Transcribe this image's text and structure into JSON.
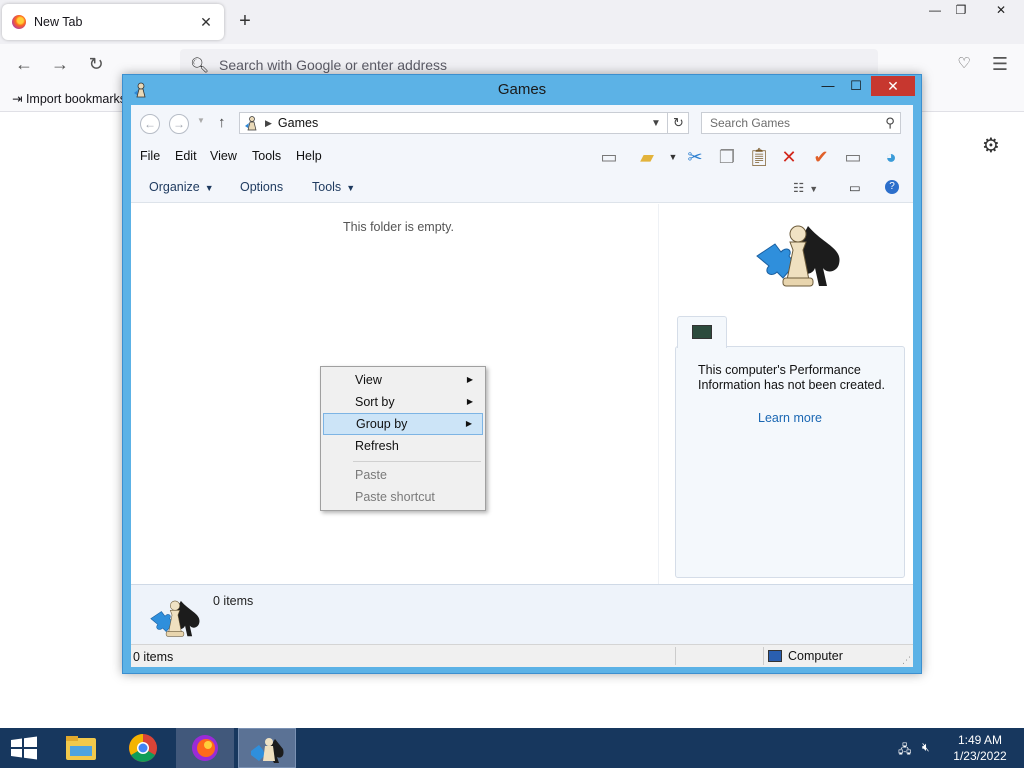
{
  "browser": {
    "tab_title": "New Tab",
    "tab_close": "✕",
    "new_tab": "+",
    "url_placeholder": "Search with Google or enter address",
    "bookmark_label": "Import bookmarks...",
    "controls": {
      "minimize": "—",
      "maximize": "❐",
      "close": "✕"
    }
  },
  "explorer": {
    "title": "Games",
    "breadcrumb": "Games",
    "search_placeholder": "Search Games",
    "menu": [
      "File",
      "Edit",
      "View",
      "Tools",
      "Help"
    ],
    "commands": {
      "organize": "Organize",
      "options": "Options",
      "tools": "Tools"
    },
    "empty_message": "This folder is empty.",
    "perf_message": "This computer's Performance Information has not been created.",
    "learn_more": "Learn more",
    "details_count": "0 items",
    "status_items": "0 items",
    "status_location": "Computer"
  },
  "context_menu": {
    "items": [
      {
        "label": "View",
        "submenu": true,
        "disabled": false
      },
      {
        "label": "Sort by",
        "submenu": true,
        "disabled": false
      },
      {
        "label": "Group by",
        "submenu": true,
        "disabled": false,
        "highlighted": true
      },
      {
        "label": "Refresh",
        "submenu": false,
        "disabled": false
      },
      {
        "label": "Paste",
        "submenu": false,
        "disabled": true
      },
      {
        "label": "Paste shortcut",
        "submenu": false,
        "disabled": true
      }
    ]
  },
  "taskbar": {
    "apps": [
      "file-explorer",
      "chrome",
      "firefox",
      "games"
    ],
    "time": "1:49 AM",
    "date": "1/23/2022"
  },
  "colors": {
    "window_frame": "#5cb2e6",
    "close_button": "#c7372f",
    "taskbar": "#17375e",
    "menu_highlight": "#cce4f7",
    "link": "#1a67b3"
  }
}
